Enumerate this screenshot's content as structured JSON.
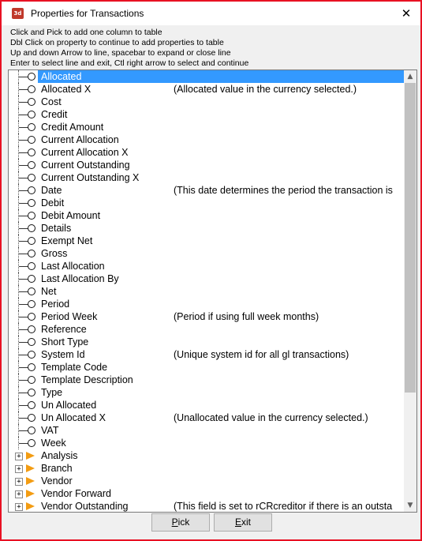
{
  "window": {
    "title": "Properties for Transactions",
    "icon_text": "3d",
    "close_glyph": "✕"
  },
  "instructions": [
    "Click and Pick to add one column to table",
    "Dbl Click on property to continue to add  properties to table",
    "Up and down Arrow to line, spacebar to expand or close line",
    "Enter to select line and exit, Ctl right arrow to select and continue"
  ],
  "properties": [
    {
      "label": "Allocated",
      "desc": "",
      "type": "leaf",
      "selected": true
    },
    {
      "label": "Allocated X",
      "desc": "(Allocated value in the currency selected.)",
      "type": "leaf"
    },
    {
      "label": "Cost",
      "desc": "",
      "type": "leaf"
    },
    {
      "label": "Credit",
      "desc": "",
      "type": "leaf"
    },
    {
      "label": "Credit Amount",
      "desc": "",
      "type": "leaf"
    },
    {
      "label": "Current Allocation",
      "desc": "",
      "type": "leaf"
    },
    {
      "label": "Current Allocation X",
      "desc": "",
      "type": "leaf"
    },
    {
      "label": "Current Outstanding",
      "desc": "",
      "type": "leaf"
    },
    {
      "label": "Current Outstanding X",
      "desc": "",
      "type": "leaf"
    },
    {
      "label": "Date",
      "desc": "(This date determines the period the transaction is",
      "type": "leaf"
    },
    {
      "label": "Debit",
      "desc": "",
      "type": "leaf"
    },
    {
      "label": "Debit Amount",
      "desc": "",
      "type": "leaf"
    },
    {
      "label": "Details",
      "desc": "",
      "type": "leaf"
    },
    {
      "label": "Exempt Net",
      "desc": "",
      "type": "leaf"
    },
    {
      "label": "Gross",
      "desc": "",
      "type": "leaf"
    },
    {
      "label": "Last Allocation",
      "desc": "",
      "type": "leaf"
    },
    {
      "label": "Last Allocation By",
      "desc": "",
      "type": "leaf"
    },
    {
      "label": "Net",
      "desc": "",
      "type": "leaf"
    },
    {
      "label": "Period",
      "desc": "",
      "type": "leaf"
    },
    {
      "label": "Period Week",
      "desc": "(Period if using full week months)",
      "type": "leaf"
    },
    {
      "label": "Reference",
      "desc": "",
      "type": "leaf"
    },
    {
      "label": "Short Type",
      "desc": "",
      "type": "leaf"
    },
    {
      "label": "System Id",
      "desc": "(Unique system id for all gl transactions)",
      "type": "leaf"
    },
    {
      "label": "Template Code",
      "desc": "",
      "type": "leaf"
    },
    {
      "label": "Template Description",
      "desc": "",
      "type": "leaf"
    },
    {
      "label": "Type",
      "desc": "",
      "type": "leaf"
    },
    {
      "label": "Un Allocated",
      "desc": "",
      "type": "leaf"
    },
    {
      "label": "Un Allocated X",
      "desc": "(Unallocated value in the currency selected.)",
      "type": "leaf"
    },
    {
      "label": "VAT",
      "desc": "",
      "type": "leaf"
    },
    {
      "label": "Week",
      "desc": "",
      "type": "leaf"
    },
    {
      "label": "Analysis",
      "desc": "",
      "type": "group"
    },
    {
      "label": "Branch",
      "desc": "",
      "type": "group"
    },
    {
      "label": "Vendor",
      "desc": "",
      "type": "group"
    },
    {
      "label": "Vendor Forward",
      "desc": "",
      "type": "group"
    },
    {
      "label": "Vendor Outstanding",
      "desc": "(This field is set to rCRcreditor if there is an outsta",
      "type": "group"
    }
  ],
  "buttons": {
    "pick_first": "P",
    "pick_rest": "ick",
    "exit_first": "E",
    "exit_rest": "xit"
  },
  "scrollbar": {
    "up_glyph": "▲",
    "down_glyph": "▼"
  },
  "colors": {
    "selection": "#3399ff",
    "frame": "#e81123",
    "group_arrow": "#f39c12"
  }
}
